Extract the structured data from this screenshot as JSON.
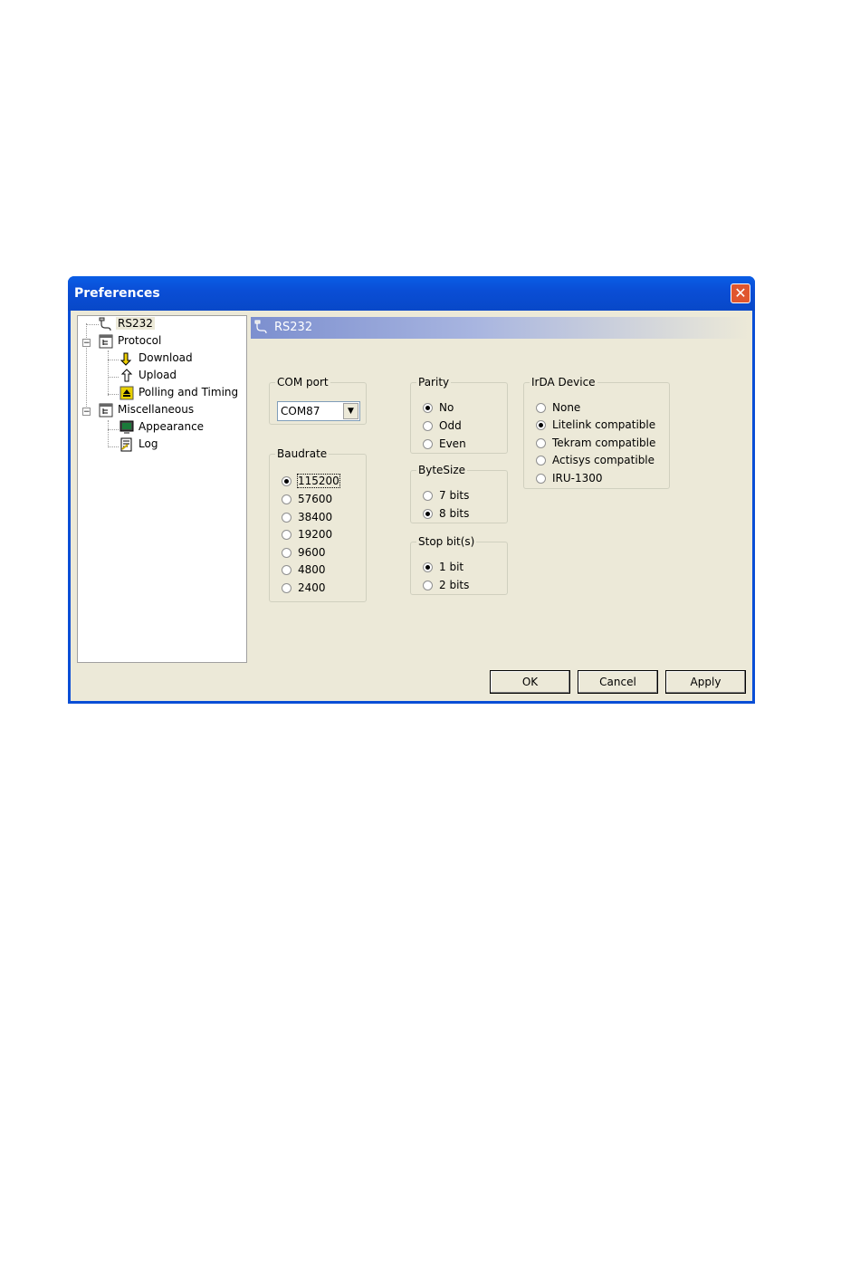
{
  "window": {
    "title": "Preferences",
    "close_label": "✕"
  },
  "tree": {
    "items": [
      {
        "label": "RS232",
        "icon": "serial-cable-icon"
      },
      {
        "label": "Protocol",
        "icon": "protocol-icon"
      },
      {
        "label": "Download",
        "icon": "download-arrow-icon"
      },
      {
        "label": "Upload",
        "icon": "upload-arrow-icon"
      },
      {
        "label": "Polling and Timing",
        "icon": "eject-icon"
      },
      {
        "label": "Miscellaneous",
        "icon": "misc-icon"
      },
      {
        "label": "Appearance",
        "icon": "monitor-icon"
      },
      {
        "label": "Log",
        "icon": "log-icon"
      }
    ]
  },
  "header": {
    "title": "RS232"
  },
  "com_port": {
    "legend": "COM port",
    "value": "COM87"
  },
  "baudrate": {
    "legend": "Baudrate",
    "options": [
      "115200",
      "57600",
      "38400",
      "19200",
      "9600",
      "4800",
      "2400"
    ],
    "selected": "115200"
  },
  "parity": {
    "legend": "Parity",
    "options": [
      "No",
      "Odd",
      "Even"
    ],
    "selected": "No"
  },
  "bytesize": {
    "legend": "ByteSize",
    "options": [
      "7 bits",
      "8 bits"
    ],
    "selected": "8 bits"
  },
  "stopbits": {
    "legend": "Stop bit(s)",
    "options": [
      "1 bit",
      "2 bits"
    ],
    "selected": "1 bit"
  },
  "irda": {
    "legend": "IrDA Device",
    "options": [
      "None",
      "Litelink compatible",
      "Tekram compatible",
      "Actisys compatible",
      "IRU-1300"
    ],
    "selected": "Litelink compatible"
  },
  "buttons": {
    "ok": "OK",
    "cancel": "Cancel",
    "apply": "Apply"
  }
}
